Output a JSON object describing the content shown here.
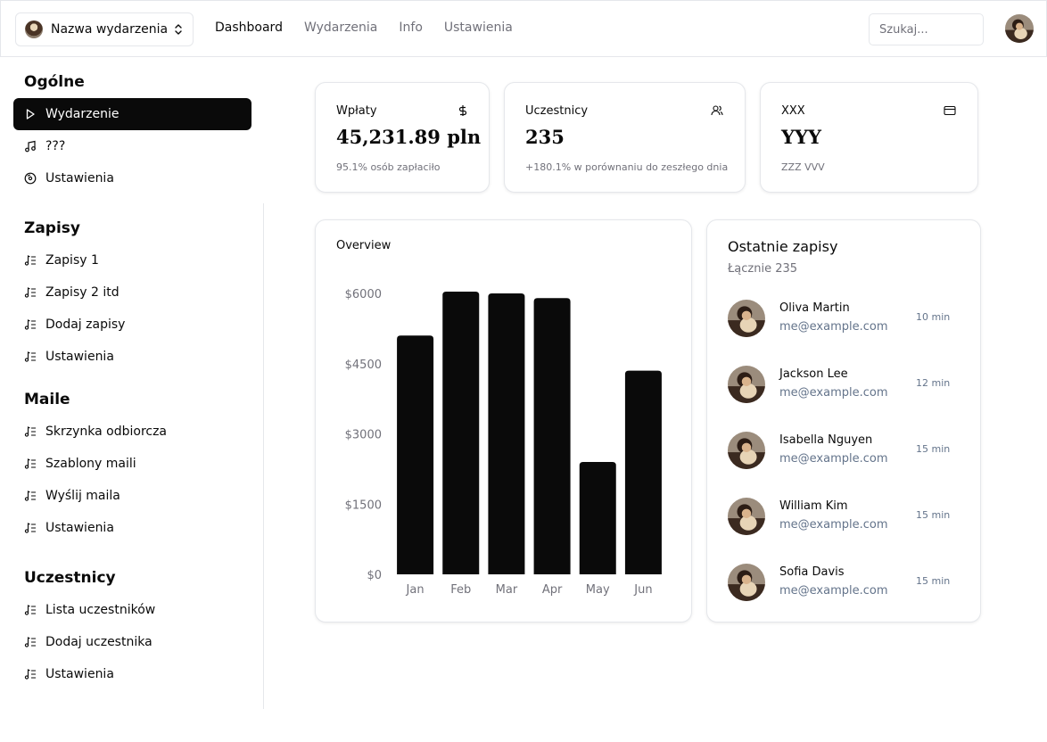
{
  "header": {
    "event_name": "Nazwa wydarzenia",
    "nav": [
      "Dashboard",
      "Wydarzenia",
      "Info",
      "Ustawienia"
    ],
    "search_placeholder": "Szukaj..."
  },
  "sidebar": {
    "sections": [
      {
        "title": "Ogólne",
        "items": [
          "Wydarzenie",
          "???",
          "Ustawienia"
        ]
      },
      {
        "title": "Zapisy",
        "items": [
          "Zapisy 1",
          "Zapisy 2 itd",
          "Dodaj zapisy",
          "Ustawienia"
        ]
      },
      {
        "title": "Maile",
        "items": [
          "Skrzynka odbiorcza",
          "Szablony maili",
          "Wyślij maila",
          "Ustawienia"
        ]
      },
      {
        "title": "Uczestnicy",
        "items": [
          "Lista uczestników",
          "Dodaj uczestnika",
          "Ustawienia"
        ]
      }
    ]
  },
  "stats": [
    {
      "title": "Wpłaty",
      "value": "45,231.89 pln",
      "sub": "95.1% osób zapłaciło",
      "icon": "dollar-icon"
    },
    {
      "title": "Uczestnicy",
      "value": "235",
      "sub": "+180.1% w porównaniu do zeszłego dnia",
      "icon": "users-icon"
    },
    {
      "title": "XXX",
      "value": "YYY",
      "sub": "ZZZ VVV",
      "icon": "credit-card-icon"
    }
  ],
  "overview": {
    "title": "Overview"
  },
  "chart_data": {
    "type": "bar",
    "categories": [
      "Jan",
      "Feb",
      "Mar",
      "Apr",
      "May",
      "Jun"
    ],
    "values": [
      5100,
      6150,
      6000,
      5900,
      2400,
      4350
    ],
    "ylim": [
      0,
      6000
    ],
    "yticks": [
      0,
      1500,
      3000,
      4500,
      6000
    ],
    "ytick_labels": [
      "$0",
      "$1500",
      "$3000",
      "$4500",
      "$6000"
    ],
    "bar_color": "#0a0a0a",
    "grid": false
  },
  "recent": {
    "title": "Ostatnie zapisy",
    "subtitle": "Łącznie 235",
    "entries": [
      {
        "name": "Oliva Martin",
        "email": "me@example.com",
        "time": "10 min"
      },
      {
        "name": "Jackson Lee",
        "email": "me@example.com",
        "time": "12 min"
      },
      {
        "name": "Isabella Nguyen",
        "email": "me@example.com",
        "time": "15 min"
      },
      {
        "name": "William Kim",
        "email": "me@example.com",
        "time": "15 min"
      },
      {
        "name": "Sofia Davis",
        "email": "me@example.com",
        "time": "15 min"
      }
    ]
  },
  "colors": {
    "accent": "#0a0a0a",
    "muted_text": "#71717a",
    "border": "#e5e7eb",
    "email_text": "#64748b"
  }
}
